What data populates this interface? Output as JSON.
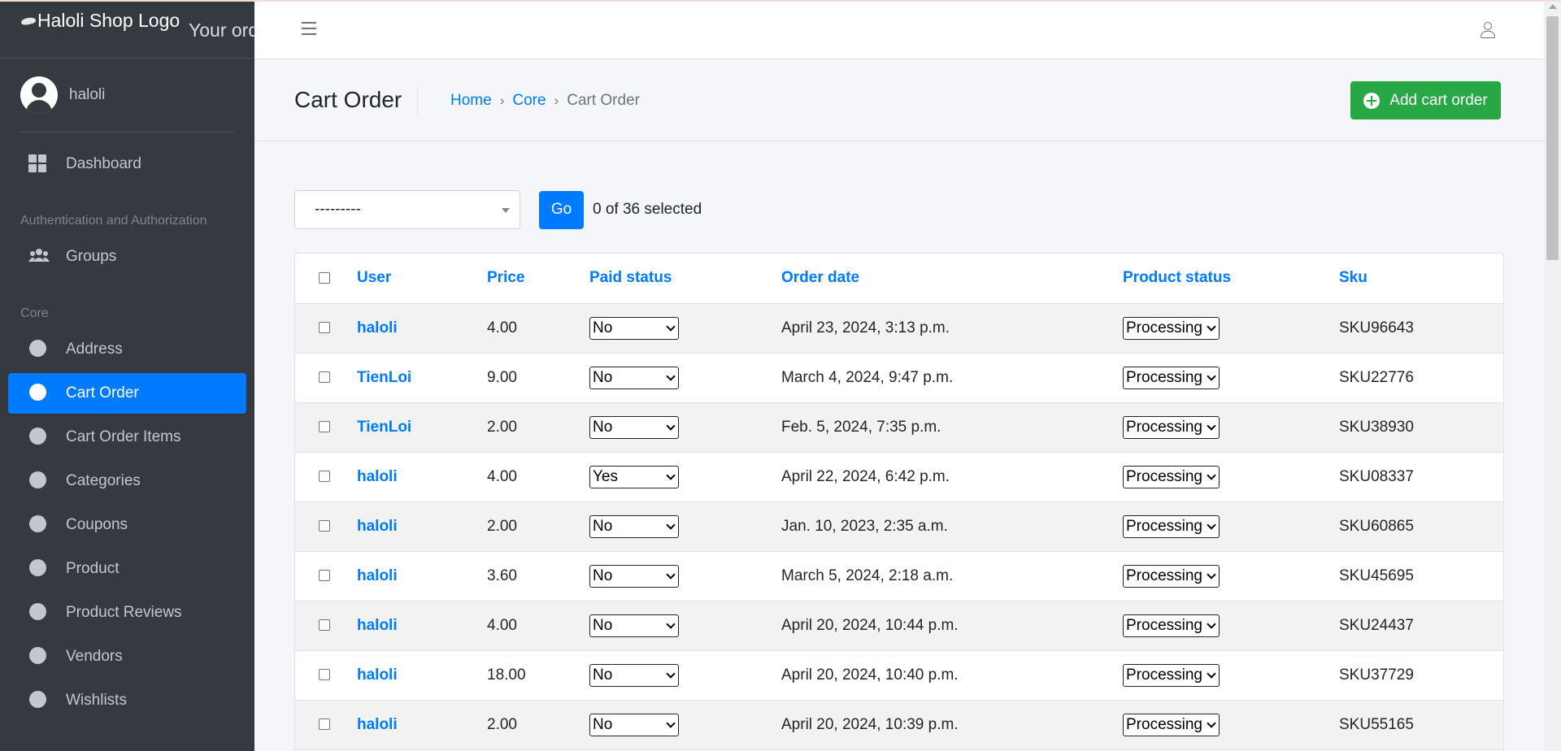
{
  "brand": {
    "logo_alt": "Haloli Shop Logo",
    "tagline": "Your ord"
  },
  "user": {
    "name": "haloli"
  },
  "sidebar": {
    "dashboard": "Dashboard",
    "section_auth": "Authentication and Authorization",
    "groups": "Groups",
    "section_core": "Core",
    "items": [
      {
        "label": "Address"
      },
      {
        "label": "Cart Order"
      },
      {
        "label": "Cart Order Items"
      },
      {
        "label": "Categories"
      },
      {
        "label": "Coupons"
      },
      {
        "label": "Product"
      },
      {
        "label": "Product Reviews"
      },
      {
        "label": "Vendors"
      },
      {
        "label": "Wishlists"
      }
    ],
    "active_item": "Cart Order"
  },
  "header": {
    "title": "Cart Order",
    "breadcrumb": {
      "home": "Home",
      "core": "Core",
      "current": "Cart Order"
    },
    "add_button": "Add cart order"
  },
  "actions": {
    "select_value": "---------",
    "go_label": "Go",
    "selected_text": "0 of 36 selected"
  },
  "table": {
    "columns": [
      "User",
      "Price",
      "Paid status",
      "Order date",
      "Product status",
      "Sku"
    ],
    "rows": [
      {
        "user": "haloli",
        "price": "4.00",
        "paid": "No",
        "date": "April 23, 2024, 3:13 p.m.",
        "status": "Processing",
        "sku": "SKU96643"
      },
      {
        "user": "TienLoi",
        "price": "9.00",
        "paid": "No",
        "date": "March 4, 2024, 9:47 p.m.",
        "status": "Processing",
        "sku": "SKU22776"
      },
      {
        "user": "TienLoi",
        "price": "2.00",
        "paid": "No",
        "date": "Feb. 5, 2024, 7:35 p.m.",
        "status": "Processing",
        "sku": "SKU38930"
      },
      {
        "user": "haloli",
        "price": "4.00",
        "paid": "Yes",
        "date": "April 22, 2024, 6:42 p.m.",
        "status": "Processing",
        "sku": "SKU08337"
      },
      {
        "user": "haloli",
        "price": "2.00",
        "paid": "No",
        "date": "Jan. 10, 2023, 2:35 a.m.",
        "status": "Processing",
        "sku": "SKU60865"
      },
      {
        "user": "haloli",
        "price": "3.60",
        "paid": "No",
        "date": "March 5, 2024, 2:18 a.m.",
        "status": "Processing",
        "sku": "SKU45695"
      },
      {
        "user": "haloli",
        "price": "4.00",
        "paid": "No",
        "date": "April 20, 2024, 10:44 p.m.",
        "status": "Processing",
        "sku": "SKU24437"
      },
      {
        "user": "haloli",
        "price": "18.00",
        "paid": "No",
        "date": "April 20, 2024, 10:40 p.m.",
        "status": "Processing",
        "sku": "SKU37729"
      },
      {
        "user": "haloli",
        "price": "2.00",
        "paid": "No",
        "date": "April 20, 2024, 10:39 p.m.",
        "status": "Processing",
        "sku": "SKU55165"
      }
    ]
  },
  "colors": {
    "sidebar_bg": "#343a40",
    "primary": "#007bff",
    "success": "#28a745"
  }
}
